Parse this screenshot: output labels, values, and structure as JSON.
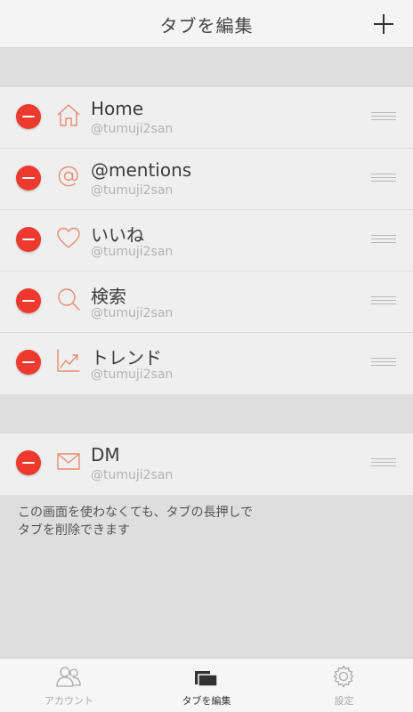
{
  "header": {
    "title": "タブを編集",
    "add_icon": "plus-icon"
  },
  "tabs_section": [
    {
      "title": "Home",
      "account": "@tumuji2san",
      "icon": "home-icon"
    },
    {
      "title": "@mentions",
      "account": "@tumuji2san",
      "icon": "at-icon"
    },
    {
      "title": "いいね",
      "account": "@tumuji2san",
      "icon": "heart-icon"
    },
    {
      "title": "検索",
      "account": "@tumuji2san",
      "icon": "search-icon"
    },
    {
      "title": "トレンド",
      "account": "@tumuji2san",
      "icon": "trend-icon"
    }
  ],
  "dm_section": [
    {
      "title": "DM",
      "account": "@tumuji2san",
      "icon": "mail-icon"
    }
  ],
  "note": {
    "line1": "この画面を使わなくても、タブの長押しで",
    "line2": "タブを削除できます"
  },
  "tabbar": {
    "items": [
      {
        "label": "アカウント",
        "icon": "accounts-icon",
        "active": false
      },
      {
        "label": "タブを編集",
        "icon": "tabs-edit-icon",
        "active": true
      },
      {
        "label": "設定",
        "icon": "gear-icon",
        "active": false
      }
    ]
  },
  "colors": {
    "delete": "#ee3a2e",
    "icon_accent": "#e88c6e",
    "background": "#dedede",
    "row_background": "#efefef"
  }
}
